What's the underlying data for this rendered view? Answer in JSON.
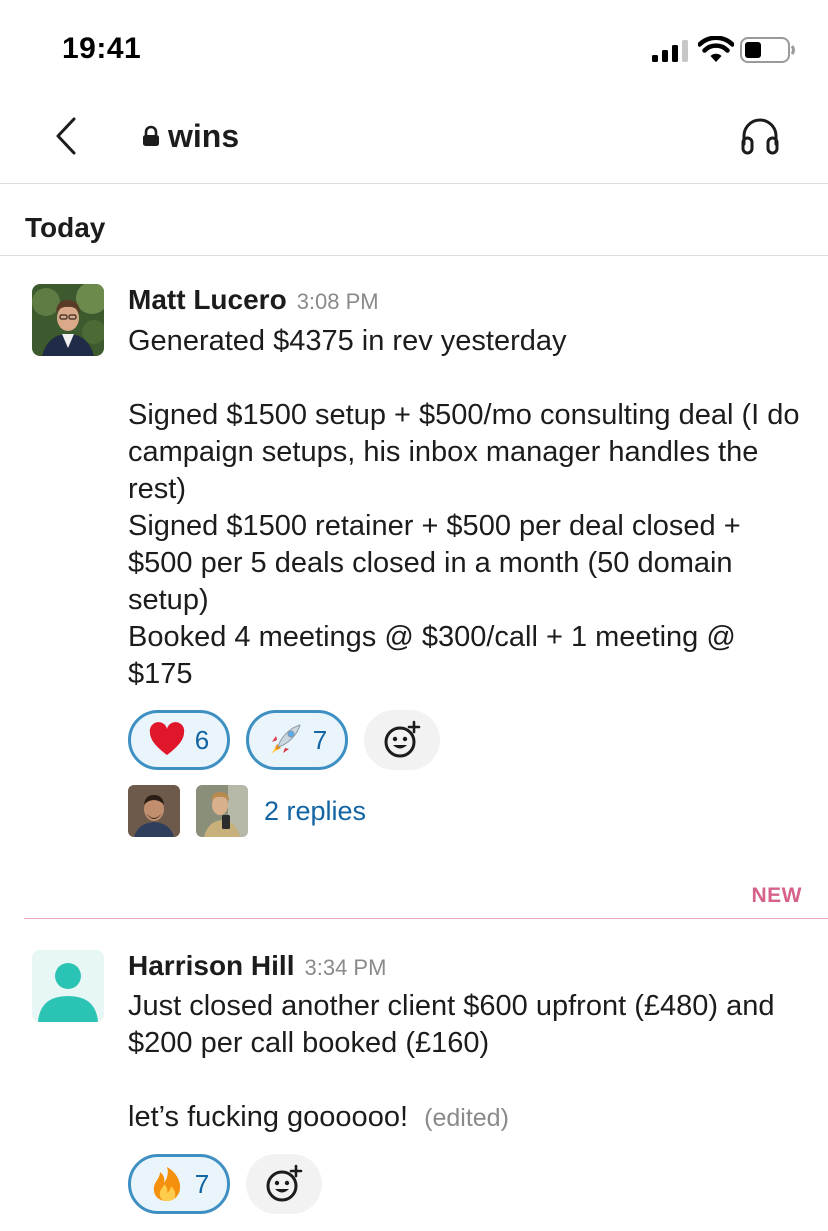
{
  "status_bar": {
    "time": "19:41"
  },
  "header": {
    "channel_name": "wins"
  },
  "day_divider": "Today",
  "new_marker": "NEW",
  "messages": [
    {
      "author": "Matt Lucero",
      "time": "3:08 PM",
      "body": "Generated $4375 in rev yesterday\n\nSigned $1500 setup + $500/mo consulting deal (I do campaign setups, his inbox manager handles the rest)\nSigned $1500 retainer + $500 per deal closed + $500 per 5 deals closed in a month (50 domain setup)\nBooked 4 meetings @ $300/call + 1 meeting @ $175",
      "reactions": [
        {
          "emoji": "heart-emoji",
          "count": "6"
        },
        {
          "emoji": "rocket-emoji",
          "count": "7"
        }
      ],
      "replies_label": "2 replies"
    },
    {
      "author": "Harrison Hill",
      "time": "3:34 PM",
      "body": "Just closed another client $600 upfront (£480) and $200 per call booked (£160)\n\nlet’s fucking goooooo!",
      "edited": "(edited)",
      "reactions": [
        {
          "emoji": "fire-emoji",
          "count": "7"
        }
      ]
    }
  ],
  "colors": {
    "reaction_border": "#3f90c2",
    "reaction_bg": "#eaf5fb",
    "link": "#1264a3",
    "new_marker": "#d6628c",
    "avatar_teal": "#2bc4b4"
  }
}
